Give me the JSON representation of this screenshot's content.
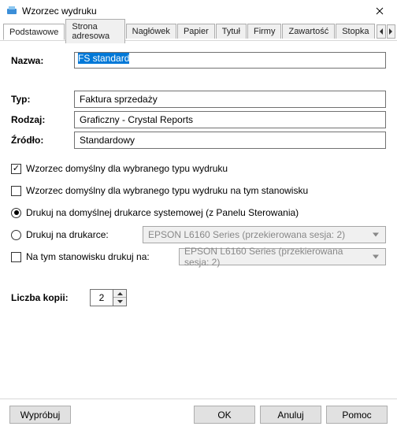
{
  "window_title": "Wzorzec wydruku",
  "tabs": [
    "Podstawowe",
    "Strona adresowa",
    "Nagłówek",
    "Papier",
    "Tytuł",
    "Firmy",
    "Zawartość",
    "Stopka"
  ],
  "name_label": "Nazwa:",
  "name_value": "FS standard",
  "type_label": "Typ:",
  "type_value": "Faktura sprzedaży",
  "kind_label": "Rodzaj:",
  "kind_value": "Graficzny - Crystal Reports",
  "source_label": "Źródło:",
  "source_value": "Standardowy",
  "check_default_template": "Wzorzec domyślny dla wybranego typu wydruku",
  "check_default_station": "Wzorzec domyślny dla wybranego typu wydruku na tym stanowisku",
  "radio_system_printer": "Drukuj na domyślnej drukarce systemowej (z Panelu Sterowania)",
  "radio_printer": "Drukuj na drukarce:",
  "check_station_printer": "Na tym stanowisku drukuj na:",
  "printer_value": "EPSON L6160 Series (przekierowana sesja: 2)",
  "copies_label": "Liczba kopii:",
  "copies_value": "2",
  "btn_try": "Wypróbuj",
  "btn_ok": "OK",
  "btn_cancel": "Anuluj",
  "btn_help": "Pomoc"
}
